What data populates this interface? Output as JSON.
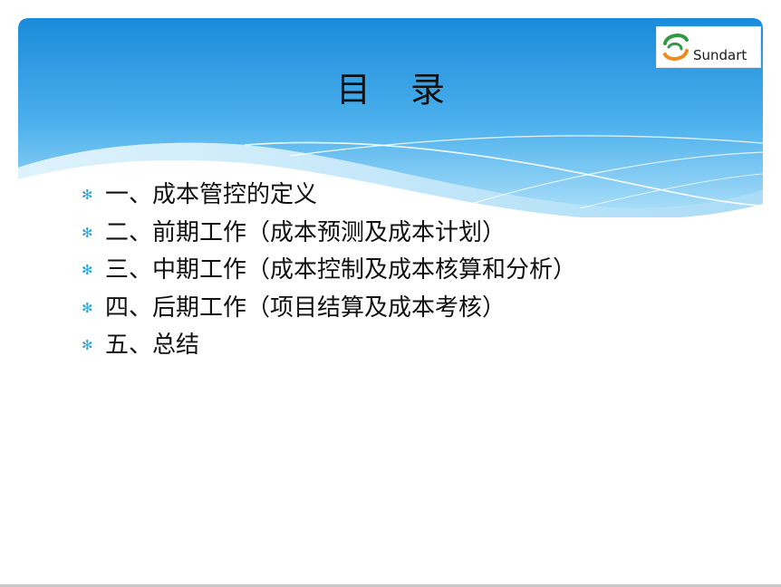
{
  "title": {
    "char1": "目",
    "char2": "录"
  },
  "logo": {
    "text": "Sundart",
    "icon": "sundart-swirl-logo"
  },
  "toc": {
    "bullet_icon": "asterisk-bullet",
    "bullet_color": "#29a3d9",
    "items": [
      "一、成本管控的定义",
      "二、前期工作（成本预测及成本计划）",
      "三、中期工作（成本控制及成本核算和分析）",
      "四、后期工作（项目结算及成本考核）",
      "五、总结"
    ]
  },
  "colors": {
    "header_top": "#1e8fdc",
    "header_bottom": "#8fd2f6",
    "logo_green": "#2e9a44",
    "logo_orange": "#f08a1c"
  }
}
